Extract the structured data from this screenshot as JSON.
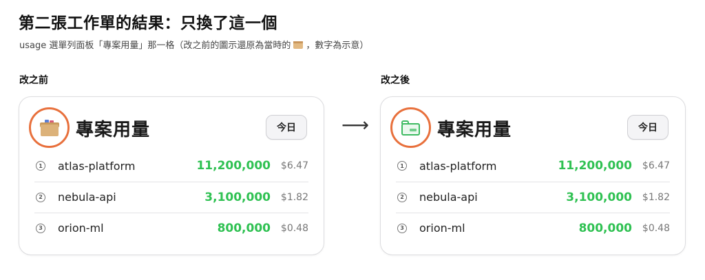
{
  "header": {
    "title": "第二張工作單的結果：只換了這一個",
    "subtitle_pre": "usage 選單列面板「專案用量」那一格（改之前的圖示還原為當時的",
    "subtitle_post": "，數字為示意）"
  },
  "before": {
    "label": "改之前",
    "icon": "package-box-icon",
    "card_title": "專案用量",
    "today_label": "今日",
    "rows": [
      {
        "rank": "1",
        "name": "atlas-platform",
        "tokens": "11,200,000",
        "cost": "$6.47"
      },
      {
        "rank": "2",
        "name": "nebula-api",
        "tokens": "3,100,000",
        "cost": "$1.82"
      },
      {
        "rank": "3",
        "name": "orion-ml",
        "tokens": "800,000",
        "cost": "$0.48"
      }
    ]
  },
  "after": {
    "label": "改之後",
    "icon": "green-folder-icon",
    "card_title": "專案用量",
    "today_label": "今日",
    "rows": [
      {
        "rank": "1",
        "name": "atlas-platform",
        "tokens": "11,200,000",
        "cost": "$6.47"
      },
      {
        "rank": "2",
        "name": "nebula-api",
        "tokens": "3,100,000",
        "cost": "$1.82"
      },
      {
        "rank": "3",
        "name": "orion-ml",
        "tokens": "800,000",
        "cost": "$0.48"
      }
    ]
  },
  "arrow": "⟶",
  "colors": {
    "accent_ring": "#e8703c",
    "token_green": "#2fc152",
    "folder_green": "#3dba61"
  }
}
